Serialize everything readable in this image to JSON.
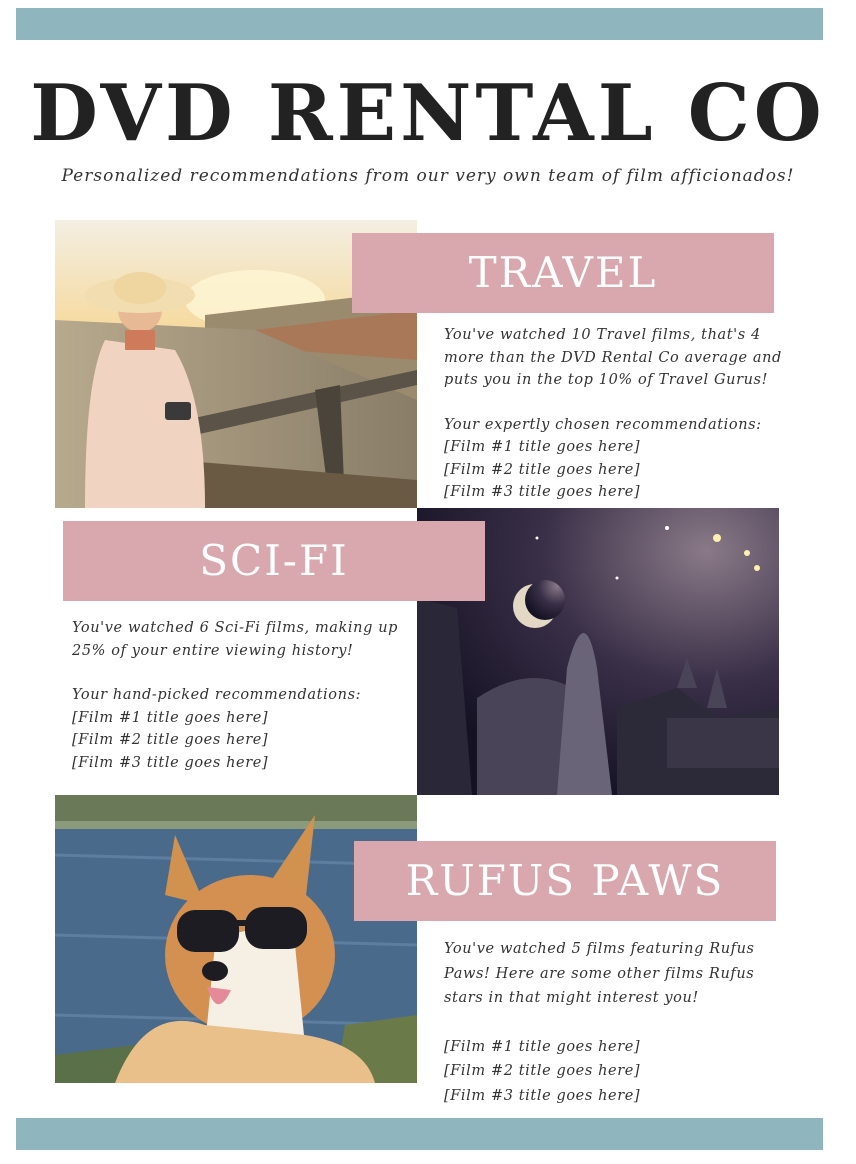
{
  "header": {
    "title": "DVD RENTAL CO",
    "subtitle": "Personalized recommendations from our very own team of film afficionados!"
  },
  "colors": {
    "accent_bar": "#8fb5bf",
    "banner": "#d9a8ae"
  },
  "sections": {
    "travel": {
      "heading": "TRAVEL",
      "stat_lines": [
        "You've watched 10 Travel films, that's 4",
        "more than the DVD Rental Co average and",
        "puts you in the top 10% of Travel Gurus!"
      ],
      "rec_intro": "Your expertly chosen recommendations:",
      "films": [
        "[Film #1 title goes here]",
        "[Film #2 title goes here]",
        "[Film #3 title goes here]"
      ]
    },
    "scifi": {
      "heading": "SCI-FI",
      "stat_lines": [
        "You've watched 6 Sci-Fi films, making up",
        "25% of your entire viewing history!"
      ],
      "rec_intro": "Your hand-picked recommendations:",
      "films": [
        "[Film #1 title goes here]",
        "[Film #2 title goes here]",
        "[Film #3 title goes here]"
      ]
    },
    "rufus": {
      "heading": "RUFUS PAWS",
      "stat_lines": [
        "You've watched 5 films featuring Rufus",
        "Paws! Here are some other films Rufus",
        "stars in that might interest you!"
      ],
      "films": [
        "[Film #1 title goes here]",
        "[Film #2 title goes here]",
        "[Film #3 title goes here]"
      ]
    }
  }
}
